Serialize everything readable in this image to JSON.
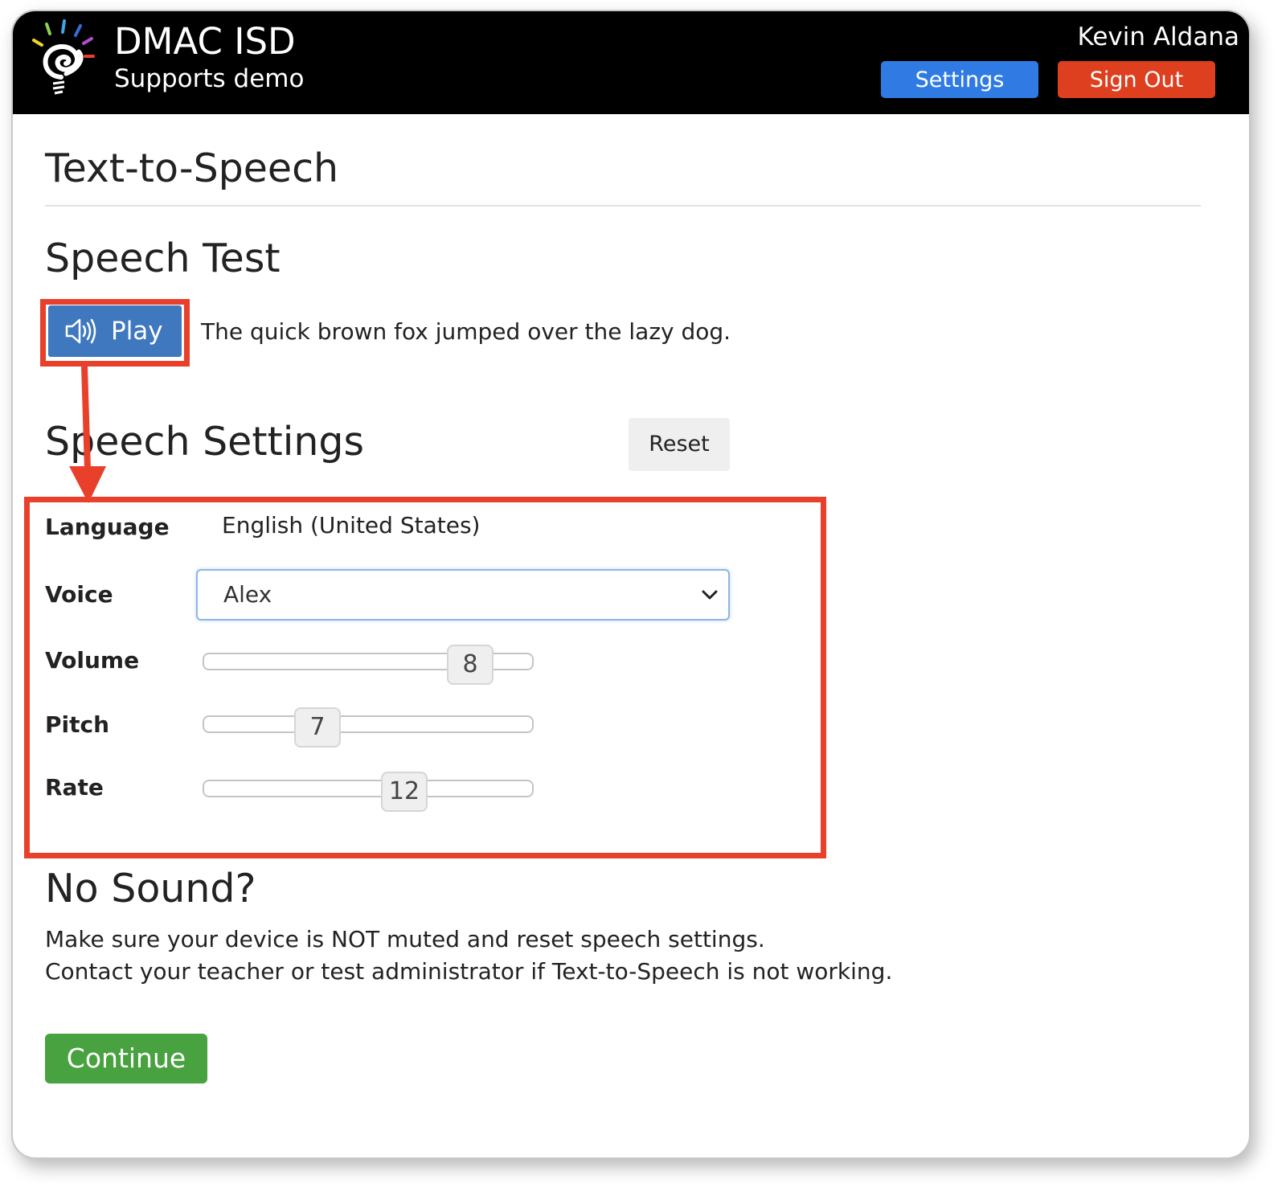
{
  "header": {
    "brand_title": "DMAC ISD",
    "brand_subtitle": "Supports demo",
    "user_name": "Kevin Aldana",
    "settings_label": "Settings",
    "signout_label": "Sign Out"
  },
  "page": {
    "title": "Text-to-Speech"
  },
  "speech_test": {
    "heading": "Speech Test",
    "play_label": "Play",
    "sample_text": "The quick brown fox jumped over the lazy dog."
  },
  "speech_settings": {
    "heading": "Speech Settings",
    "reset_label": "Reset",
    "language_label": "Language",
    "language_value": "English (United States)",
    "voice_label": "Voice",
    "voice_value": "Alex",
    "volume_label": "Volume",
    "volume_value": "8",
    "pitch_label": "Pitch",
    "pitch_value": "7",
    "rate_label": "Rate",
    "rate_value": "12"
  },
  "no_sound": {
    "heading": "No Sound?",
    "line1": "Make sure your device is NOT muted and reset speech settings.",
    "line2": "Contact your teacher or test administrator if Text-to-Speech is not working."
  },
  "continue_label": "Continue",
  "colors": {
    "header_bg": "#000000",
    "settings_btn": "#2f7be3",
    "signout_btn": "#dd3f1f",
    "play_btn": "#3f78be",
    "continue_btn": "#48a23f",
    "annotation": "#e8402a"
  }
}
